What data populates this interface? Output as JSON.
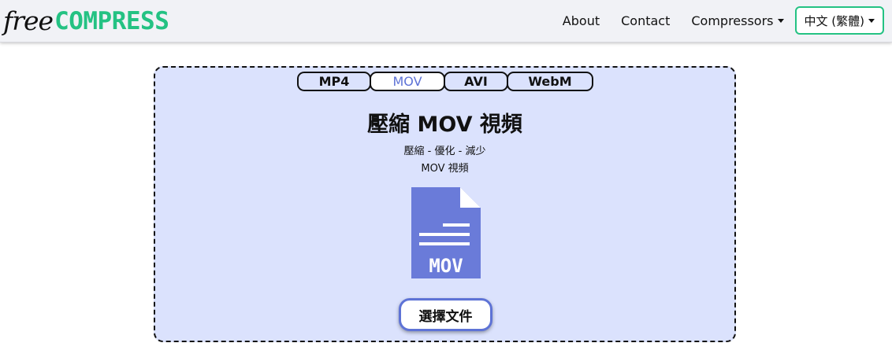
{
  "header": {
    "logo_free": "free",
    "logo_compress": "COMPRESS",
    "nav": {
      "about": "About",
      "contact": "Contact",
      "compressors": "Compressors",
      "language": "中文 (繁體)"
    }
  },
  "tabs": [
    {
      "label": "MP4",
      "active": false
    },
    {
      "label": "MOV",
      "active": true
    },
    {
      "label": "AVI",
      "active": false
    },
    {
      "label": "WebM",
      "active": false
    }
  ],
  "main": {
    "title": "壓縮 MOV 視頻",
    "subtitle_line1": "壓縮 - 優化 - 減少",
    "subtitle_line2": "MOV 視頻",
    "file_icon_label": "MOV",
    "choose_file_button": "選擇文件"
  },
  "colors": {
    "brand_green": "#24c283",
    "accent_blue": "#5e73d6",
    "icon_blue": "#6a7bd9",
    "card_bg": "#dbe2fd"
  },
  "icons": {
    "file": "file-document-icon"
  }
}
